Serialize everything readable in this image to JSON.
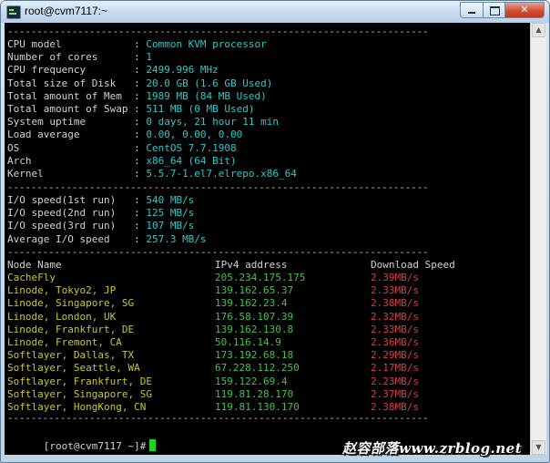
{
  "window": {
    "title": "root@cvm7117:~"
  },
  "icons": {
    "app": "terminal-icon",
    "minimize": "minimize-icon",
    "maximize": "maximize-icon",
    "close": "close-icon"
  },
  "separator": "------------------------------------------------------------------------",
  "system_info": [
    {
      "label": "CPU model           ",
      "value": "Common KVM processor"
    },
    {
      "label": "Number of cores     ",
      "value": "1"
    },
    {
      "label": "CPU frequency       ",
      "value": "2499.996 MHz"
    },
    {
      "label": "Total size of Disk  ",
      "value": "20.0 GB (1.6 GB Used)"
    },
    {
      "label": "Total amount of Mem ",
      "value": "1989 MB (84 MB Used)"
    },
    {
      "label": "Total amount of Swap",
      "value": "511 MB (0 MB Used)"
    },
    {
      "label": "System uptime       ",
      "value": "0 days, 21 hour 11 min"
    },
    {
      "label": "Load average        ",
      "value": "0.00, 0.00, 0.00"
    },
    {
      "label": "OS                  ",
      "value": "CentOS 7.7.1908"
    },
    {
      "label": "Arch                ",
      "value": "x86_64 (64 Bit)"
    },
    {
      "label": "Kernel              ",
      "value": "5.5.7-1.el7.elrepo.x86_64"
    }
  ],
  "io": [
    {
      "label": "I/O speed(1st run)  ",
      "value": "540 MB/s"
    },
    {
      "label": "I/O speed(2nd run)  ",
      "value": "125 MB/s"
    },
    {
      "label": "I/O speed(3rd run)  ",
      "value": "107 MB/s"
    },
    {
      "label": "Average I/O speed   ",
      "value": "257.3 MB/s"
    }
  ],
  "speed_table": {
    "headers": [
      "Node Name",
      "IPv4 address",
      "Download Speed"
    ],
    "rows": [
      {
        "name": "CacheFly",
        "ip": "205.234.175.175",
        "speed": "2.39MB/s"
      },
      {
        "name": "Linode, Tokyo2, JP",
        "ip": "139.162.65.37",
        "speed": "2.33MB/s"
      },
      {
        "name": "Linode, Singapore, SG",
        "ip": "139.162.23.4",
        "speed": "2.38MB/s"
      },
      {
        "name": "Linode, London, UK",
        "ip": "176.58.107.39",
        "speed": "2.32MB/s"
      },
      {
        "name": "Linode, Frankfurt, DE",
        "ip": "139.162.130.8",
        "speed": "2.33MB/s"
      },
      {
        "name": "Linode, Fremont, CA",
        "ip": "50.116.14.9",
        "speed": "2.36MB/s"
      },
      {
        "name": "Softlayer, Dallas, TX",
        "ip": "173.192.68.18",
        "speed": "2.29MB/s"
      },
      {
        "name": "Softlayer, Seattle, WA",
        "ip": "67.228.112.250",
        "speed": "2.17MB/s"
      },
      {
        "name": "Softlayer, Frankfurt, DE",
        "ip": "159.122.69.4",
        "speed": "2.23MB/s"
      },
      {
        "name": "Softlayer, Singapore, SG",
        "ip": "119.81.28.170",
        "speed": "2.37MB/s"
      },
      {
        "name": "Softlayer, HongKong, CN",
        "ip": "119.81.130.170",
        "speed": "2.38MB/s"
      }
    ]
  },
  "prompt": "[root@cvm7117 ~]#",
  "watermark": "赵容部落www.zrblog.net",
  "colors": {
    "label": "#d2d2d2",
    "value": "#2fc8c8",
    "node": "#c8c832",
    "ip": "#45c24a",
    "speed": "#e03a3a",
    "cursor": "#22d422"
  }
}
